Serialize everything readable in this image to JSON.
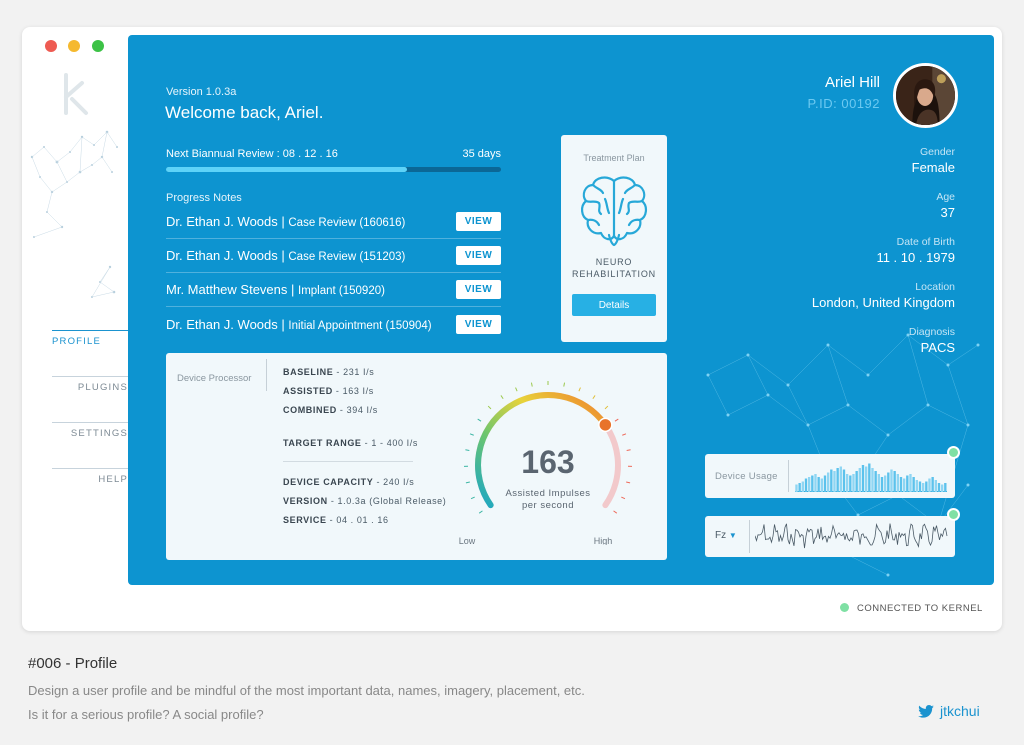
{
  "window": {
    "version": "Version 1.0.3a",
    "welcome": "Welcome back, Ariel.",
    "review": {
      "label": "Next Biannual Review : 08 . 12 . 16",
      "days": "35  days",
      "progress": 0.72
    },
    "notes_label": "Progress Notes",
    "notes": [
      {
        "doctor": "Dr. Ethan J. Woods",
        "detail": "Case Review (160616)",
        "button": "VIEW"
      },
      {
        "doctor": "Dr. Ethan J. Woods",
        "detail": "Case Review (151203)",
        "button": "VIEW"
      },
      {
        "doctor": "Mr. Matthew Stevens",
        "detail": "Implant (150920)",
        "button": "VIEW"
      },
      {
        "doctor": "Dr. Ethan J. Woods",
        "detail": "Initial Appointment (150904)",
        "button": "VIEW"
      }
    ],
    "treatment": {
      "title": "Treatment Plan",
      "name_line1": "NEURO",
      "name_line2": "REHABILITATION",
      "button": "Details",
      "icon": "brain-icon"
    },
    "device": {
      "title": "Device Processor",
      "baseline_label": "BASELINE",
      "baseline_value": " - 231 I/s",
      "assisted_label": "ASSISTED",
      "assisted_value": " - 163 I/s",
      "combined_label": "COMBINED",
      "combined_value": " - 394 I/s",
      "target_label": "TARGET RANGE",
      "target_value": " - 1 - 400 I/s",
      "capacity_label": "DEVICE CAPACITY",
      "capacity_value": " - 240 I/s",
      "version_label": "VERSION",
      "version_value": " - 1.0.3a (Global Release)",
      "service_label": "SERVICE",
      "service_value": " - 04 . 01 . 16",
      "gauge": {
        "value": "163",
        "caption_line1": "Assisted Impulses",
        "caption_line2": "per second",
        "low": "Low",
        "high": "High",
        "fraction": 0.72
      }
    },
    "profile": {
      "name": "Ariel Hill",
      "pid": "P.ID: 00192",
      "gender_label": "Gender",
      "gender": "Female",
      "age_label": "Age",
      "age": "37",
      "dob_label": "Date of Birth",
      "dob": "11 . 10 . 1979",
      "location_label": "Location",
      "location": "London, United Kingdom",
      "diagnosis_label": "Diagnosis",
      "diagnosis": "PACS"
    },
    "usage": {
      "label": "Device Usage",
      "bars": [
        0.25,
        0.3,
        0.35,
        0.45,
        0.5,
        0.55,
        0.6,
        0.5,
        0.45,
        0.55,
        0.65,
        0.75,
        0.7,
        0.8,
        0.85,
        0.75,
        0.6,
        0.55,
        0.6,
        0.7,
        0.8,
        0.9,
        0.85,
        0.95,
        0.8,
        0.7,
        0.6,
        0.5,
        0.55,
        0.65,
        0.75,
        0.7,
        0.6,
        0.5,
        0.45,
        0.55,
        0.6,
        0.5,
        0.4,
        0.35,
        0.3,
        0.35,
        0.45,
        0.5,
        0.4,
        0.3,
        0.25,
        0.3
      ]
    },
    "wave": {
      "channel": "Fz"
    },
    "nav": [
      "PROFILE",
      "PLUGINS",
      "SETTINGS",
      "HELP"
    ],
    "status": "CONNECTED TO KERNEL",
    "colors": {
      "panel": "#0d94d0",
      "accent": "#27b0e4",
      "status": "#7fe0a4"
    }
  },
  "caption": {
    "title": "#006 - Profile",
    "line1": "Design a user profile and be mindful of the most important data, names, imagery, placement, etc.",
    "line2": "Is it for a serious profile? A social profile?",
    "twitter": "jtkchui",
    "twitter_icon": "twitter-bird-icon"
  }
}
